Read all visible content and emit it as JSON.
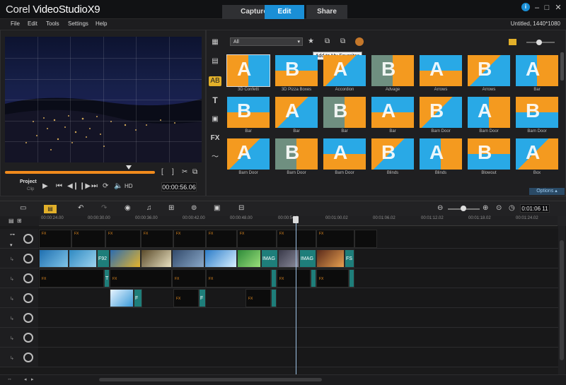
{
  "app": {
    "logo_prefix": "Corel",
    "logo_name": "VideoStudio",
    "logo_version": "X9"
  },
  "steps": [
    {
      "label": "Capture"
    },
    {
      "label": "Edit"
    },
    {
      "label": "Share"
    }
  ],
  "window_buttons": {
    "info": "i",
    "minimize": "–",
    "maximize": "□",
    "close": "✕"
  },
  "menu": [
    "File",
    "Edit",
    "Tools",
    "Settings",
    "Help"
  ],
  "project_info": "Untitled, 1440*1080",
  "player": {
    "mode_project": "Project",
    "mode_clip": "Clip",
    "timecode": "00:00:56.06",
    "hd": "HD"
  },
  "library": {
    "filter_value": "All",
    "tooltip": "Add to My Favorites",
    "options_label": "Options",
    "thumbnails": [
      {
        "label": "3D Confetti"
      },
      {
        "label": "3D Pizza Boxes"
      },
      {
        "label": "Accordion"
      },
      {
        "label": "Advage"
      },
      {
        "label": "Arrows"
      },
      {
        "label": "Arrows"
      },
      {
        "label": "Bar"
      },
      {
        "label": "Bar"
      },
      {
        "label": "Bar"
      },
      {
        "label": "Bar"
      },
      {
        "label": "Bar"
      },
      {
        "label": "Barn Door"
      },
      {
        "label": "Barn Door"
      },
      {
        "label": "Barn Door"
      },
      {
        "label": "Barn Door"
      },
      {
        "label": "Barn Door"
      },
      {
        "label": "Barn Door"
      },
      {
        "label": "Blinds"
      },
      {
        "label": "Blinds"
      },
      {
        "label": "Blowout"
      },
      {
        "label": "Box"
      }
    ]
  },
  "timeline": {
    "timecode": "0:01:06 11",
    "ruler": [
      "00:00:24.00",
      "00:00:30.00",
      "00:00:36.00",
      "00:00:42.00",
      "00:00:48.00",
      "00:00:54.0",
      "00:01:00.02",
      "00:01:06.02",
      "00:01:12.02",
      "00:01:18.02",
      "00:01:24.02"
    ],
    "clip_labels": {
      "fx": "FX",
      "f92": "F92",
      "image1": "IMAG",
      "image2": "IMAG",
      "fs": "FS",
      "t": "T",
      "f": "F"
    }
  },
  "colors": {
    "accent": "#1a8fd6",
    "orange": "#f08a1c",
    "thumb_blue": "#29a9e6",
    "thumb_orange": "#f49a1f"
  }
}
